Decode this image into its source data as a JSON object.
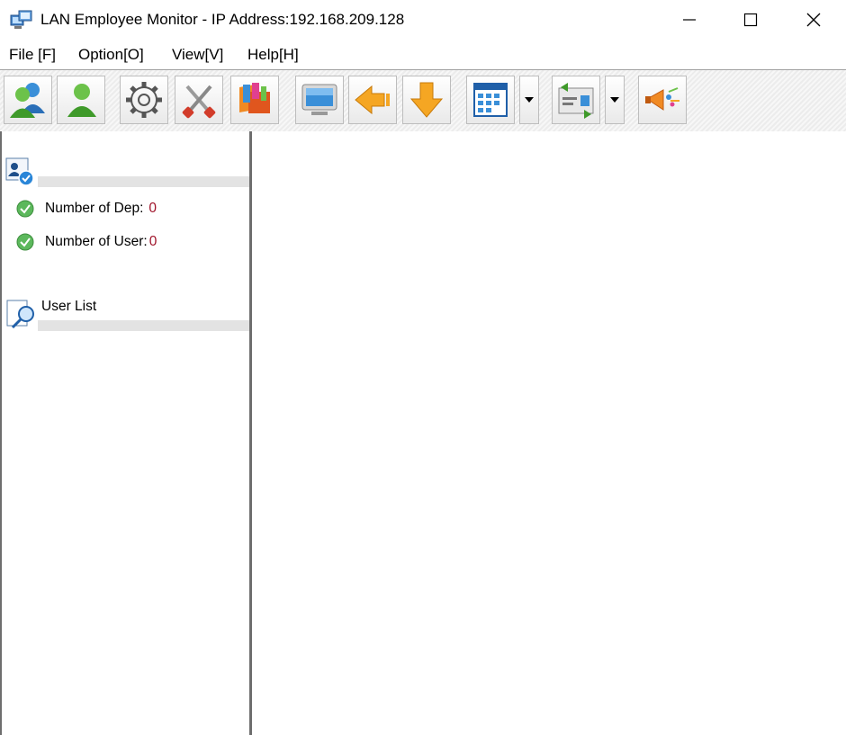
{
  "window": {
    "title": "LAN Employee Monitor - IP Address:192.168.209.128",
    "icon": "computer-monitor-icon",
    "controls": [
      "minimize-icon",
      "maximize-icon",
      "close-icon"
    ]
  },
  "menu": {
    "items": [
      {
        "label": "File [F]"
      },
      {
        "label": "Option[O]"
      },
      {
        "label": "View[V]"
      },
      {
        "label": "Help[H]"
      }
    ]
  },
  "toolbar": {
    "buttons": [
      {
        "icon": "users-group-icon"
      },
      {
        "icon": "user-icon"
      },
      {
        "icon": "gear-icon"
      },
      {
        "icon": "tools-icon"
      },
      {
        "icon": "books-icon"
      },
      {
        "icon": "monitor-icon"
      },
      {
        "icon": "arrow-left-icon"
      },
      {
        "icon": "arrow-down-icon"
      },
      {
        "icon": "calendar-grid-icon",
        "dropdown": true
      },
      {
        "icon": "transfer-card-icon",
        "dropdown": true
      },
      {
        "icon": "megaphone-icon"
      }
    ]
  },
  "sidebar": {
    "summary": {
      "icon": "user-card-check-icon",
      "stats": [
        {
          "label": "Number of Dep:",
          "value": "0",
          "icon": "check-circle-icon"
        },
        {
          "label": "Number of User:",
          "value": "0",
          "icon": "check-circle-icon"
        }
      ]
    },
    "user_list": {
      "title": "User List",
      "icon": "document-search-icon"
    }
  },
  "colors": {
    "stat_value": "#a0142a",
    "check_green": "#5cb85c",
    "divider": "#6e6e6e"
  }
}
